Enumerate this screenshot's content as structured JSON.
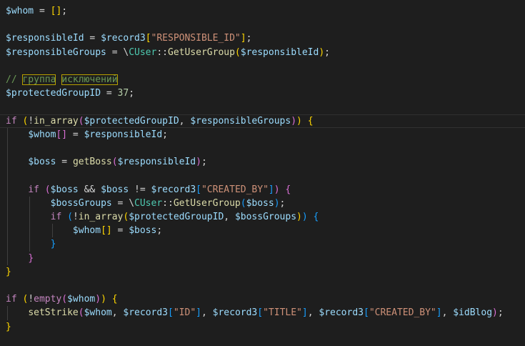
{
  "editor": {
    "language": "php",
    "theme": "dark",
    "colors": {
      "background": "#1e1e1e",
      "variable": "#9cdcfe",
      "string": "#ce9178",
      "number": "#b5cea8",
      "keyword": "#c586c0",
      "function": "#dcdcaa",
      "class": "#4ec9b0",
      "comment": "#6a9955",
      "bracket_level_1": "#ffd700",
      "bracket_level_2": "#da70d6",
      "bracket_level_3": "#179fff"
    },
    "lines": [
      {
        "tokens": [
          [
            "var",
            "$whom"
          ],
          [
            "plain",
            " = "
          ],
          [
            "b1",
            "[]"
          ],
          [
            "plain",
            ";"
          ]
        ]
      },
      {
        "tokens": []
      },
      {
        "tokens": [
          [
            "var",
            "$responsibleId"
          ],
          [
            "plain",
            " = "
          ],
          [
            "var",
            "$record3"
          ],
          [
            "b1",
            "["
          ],
          [
            "str",
            "\"RESPONSIBLE_ID\""
          ],
          [
            "b1",
            "]"
          ],
          [
            "plain",
            ";"
          ]
        ]
      },
      {
        "tokens": [
          [
            "var",
            "$responsibleGroups"
          ],
          [
            "plain",
            " = \\"
          ],
          [
            "cls",
            "CUser"
          ],
          [
            "plain",
            "::"
          ],
          [
            "fn",
            "GetUserGroup"
          ],
          [
            "b1",
            "("
          ],
          [
            "var",
            "$responsibleId"
          ],
          [
            "b1",
            ")"
          ],
          [
            "plain",
            ";"
          ]
        ]
      },
      {
        "tokens": []
      },
      {
        "tokens": [
          [
            "cmt",
            "// "
          ],
          [
            "cmtbox",
            "группа"
          ],
          [
            "cmt",
            " "
          ],
          [
            "cmtbox",
            "исключений"
          ]
        ]
      },
      {
        "tokens": [
          [
            "var",
            "$protectedGroupID"
          ],
          [
            "plain",
            " = "
          ],
          [
            "num",
            "37"
          ],
          [
            "plain",
            ";"
          ]
        ]
      },
      {
        "tokens": []
      },
      {
        "current": true,
        "tokens": [
          [
            "kw",
            "if"
          ],
          [
            "plain",
            " "
          ],
          [
            "b1",
            "("
          ],
          [
            "plain",
            "!"
          ],
          [
            "fn",
            "in_array"
          ],
          [
            "b2",
            "("
          ],
          [
            "var",
            "$protectedGroupID"
          ],
          [
            "plain",
            ", "
          ],
          [
            "var",
            "$responsibleGroups"
          ],
          [
            "b2",
            ")"
          ],
          [
            "b1",
            ")"
          ],
          [
            "plain",
            " "
          ],
          [
            "b1",
            "{"
          ]
        ]
      },
      {
        "tokens": [
          [
            "plain",
            "    "
          ],
          [
            "var",
            "$whom"
          ],
          [
            "b2",
            "[]"
          ],
          [
            "plain",
            " = "
          ],
          [
            "var",
            "$responsibleId"
          ],
          [
            "plain",
            ";"
          ]
        ]
      },
      {
        "tokens": []
      },
      {
        "tokens": [
          [
            "plain",
            "    "
          ],
          [
            "var",
            "$boss"
          ],
          [
            "plain",
            " = "
          ],
          [
            "fn",
            "getBoss"
          ],
          [
            "b2",
            "("
          ],
          [
            "var",
            "$responsibleId"
          ],
          [
            "b2",
            ")"
          ],
          [
            "plain",
            ";"
          ]
        ]
      },
      {
        "tokens": []
      },
      {
        "tokens": [
          [
            "plain",
            "    "
          ],
          [
            "kw",
            "if"
          ],
          [
            "plain",
            " "
          ],
          [
            "b2",
            "("
          ],
          [
            "var",
            "$boss"
          ],
          [
            "plain",
            " && "
          ],
          [
            "var",
            "$boss"
          ],
          [
            "plain",
            " != "
          ],
          [
            "var",
            "$record3"
          ],
          [
            "b3",
            "["
          ],
          [
            "str",
            "\"CREATED_BY\""
          ],
          [
            "b3",
            "]"
          ],
          [
            "b2",
            ")"
          ],
          [
            "plain",
            " "
          ],
          [
            "b2",
            "{"
          ]
        ]
      },
      {
        "tokens": [
          [
            "plain",
            "        "
          ],
          [
            "var",
            "$bossGroups"
          ],
          [
            "plain",
            " = \\"
          ],
          [
            "cls",
            "CUser"
          ],
          [
            "plain",
            "::"
          ],
          [
            "fn",
            "GetUserGroup"
          ],
          [
            "b3",
            "("
          ],
          [
            "var",
            "$boss"
          ],
          [
            "b3",
            ")"
          ],
          [
            "plain",
            ";"
          ]
        ]
      },
      {
        "tokens": [
          [
            "plain",
            "        "
          ],
          [
            "kw",
            "if"
          ],
          [
            "plain",
            " "
          ],
          [
            "b3",
            "("
          ],
          [
            "plain",
            "!"
          ],
          [
            "fn",
            "in_array"
          ],
          [
            "b1",
            "("
          ],
          [
            "var",
            "$protectedGroupID"
          ],
          [
            "plain",
            ", "
          ],
          [
            "var",
            "$bossGroups"
          ],
          [
            "b1",
            ")"
          ],
          [
            "b3",
            ")"
          ],
          [
            "plain",
            " "
          ],
          [
            "b3",
            "{"
          ]
        ]
      },
      {
        "tokens": [
          [
            "plain",
            "            "
          ],
          [
            "var",
            "$whom"
          ],
          [
            "b1",
            "[]"
          ],
          [
            "plain",
            " = "
          ],
          [
            "var",
            "$boss"
          ],
          [
            "plain",
            ";"
          ]
        ]
      },
      {
        "tokens": [
          [
            "plain",
            "        "
          ],
          [
            "b3",
            "}"
          ]
        ]
      },
      {
        "tokens": [
          [
            "plain",
            "    "
          ],
          [
            "b2",
            "}"
          ]
        ]
      },
      {
        "tokens": [
          [
            "b1",
            "}"
          ]
        ]
      },
      {
        "tokens": []
      },
      {
        "tokens": [
          [
            "kw",
            "if"
          ],
          [
            "plain",
            " "
          ],
          [
            "b1",
            "("
          ],
          [
            "plain",
            "!"
          ],
          [
            "kw",
            "empty"
          ],
          [
            "b2",
            "("
          ],
          [
            "var",
            "$whom"
          ],
          [
            "b2",
            ")"
          ],
          [
            "b1",
            ")"
          ],
          [
            "plain",
            " "
          ],
          [
            "b1",
            "{"
          ]
        ]
      },
      {
        "tokens": [
          [
            "plain",
            "    "
          ],
          [
            "fn",
            "setStrike"
          ],
          [
            "b2",
            "("
          ],
          [
            "var",
            "$whom"
          ],
          [
            "plain",
            ", "
          ],
          [
            "var",
            "$record3"
          ],
          [
            "b3",
            "["
          ],
          [
            "str",
            "\"ID\""
          ],
          [
            "b3",
            "]"
          ],
          [
            "plain",
            ", "
          ],
          [
            "var",
            "$record3"
          ],
          [
            "b3",
            "["
          ],
          [
            "str",
            "\"TITLE\""
          ],
          [
            "b3",
            "]"
          ],
          [
            "plain",
            ", "
          ],
          [
            "var",
            "$record3"
          ],
          [
            "b3",
            "["
          ],
          [
            "str",
            "\"CREATED_BY\""
          ],
          [
            "b3",
            "]"
          ],
          [
            "plain",
            ", "
          ],
          [
            "var",
            "$idBlog"
          ],
          [
            "b2",
            ")"
          ],
          [
            "plain",
            ";"
          ]
        ]
      },
      {
        "tokens": [
          [
            "b1",
            "}"
          ]
        ]
      }
    ]
  }
}
